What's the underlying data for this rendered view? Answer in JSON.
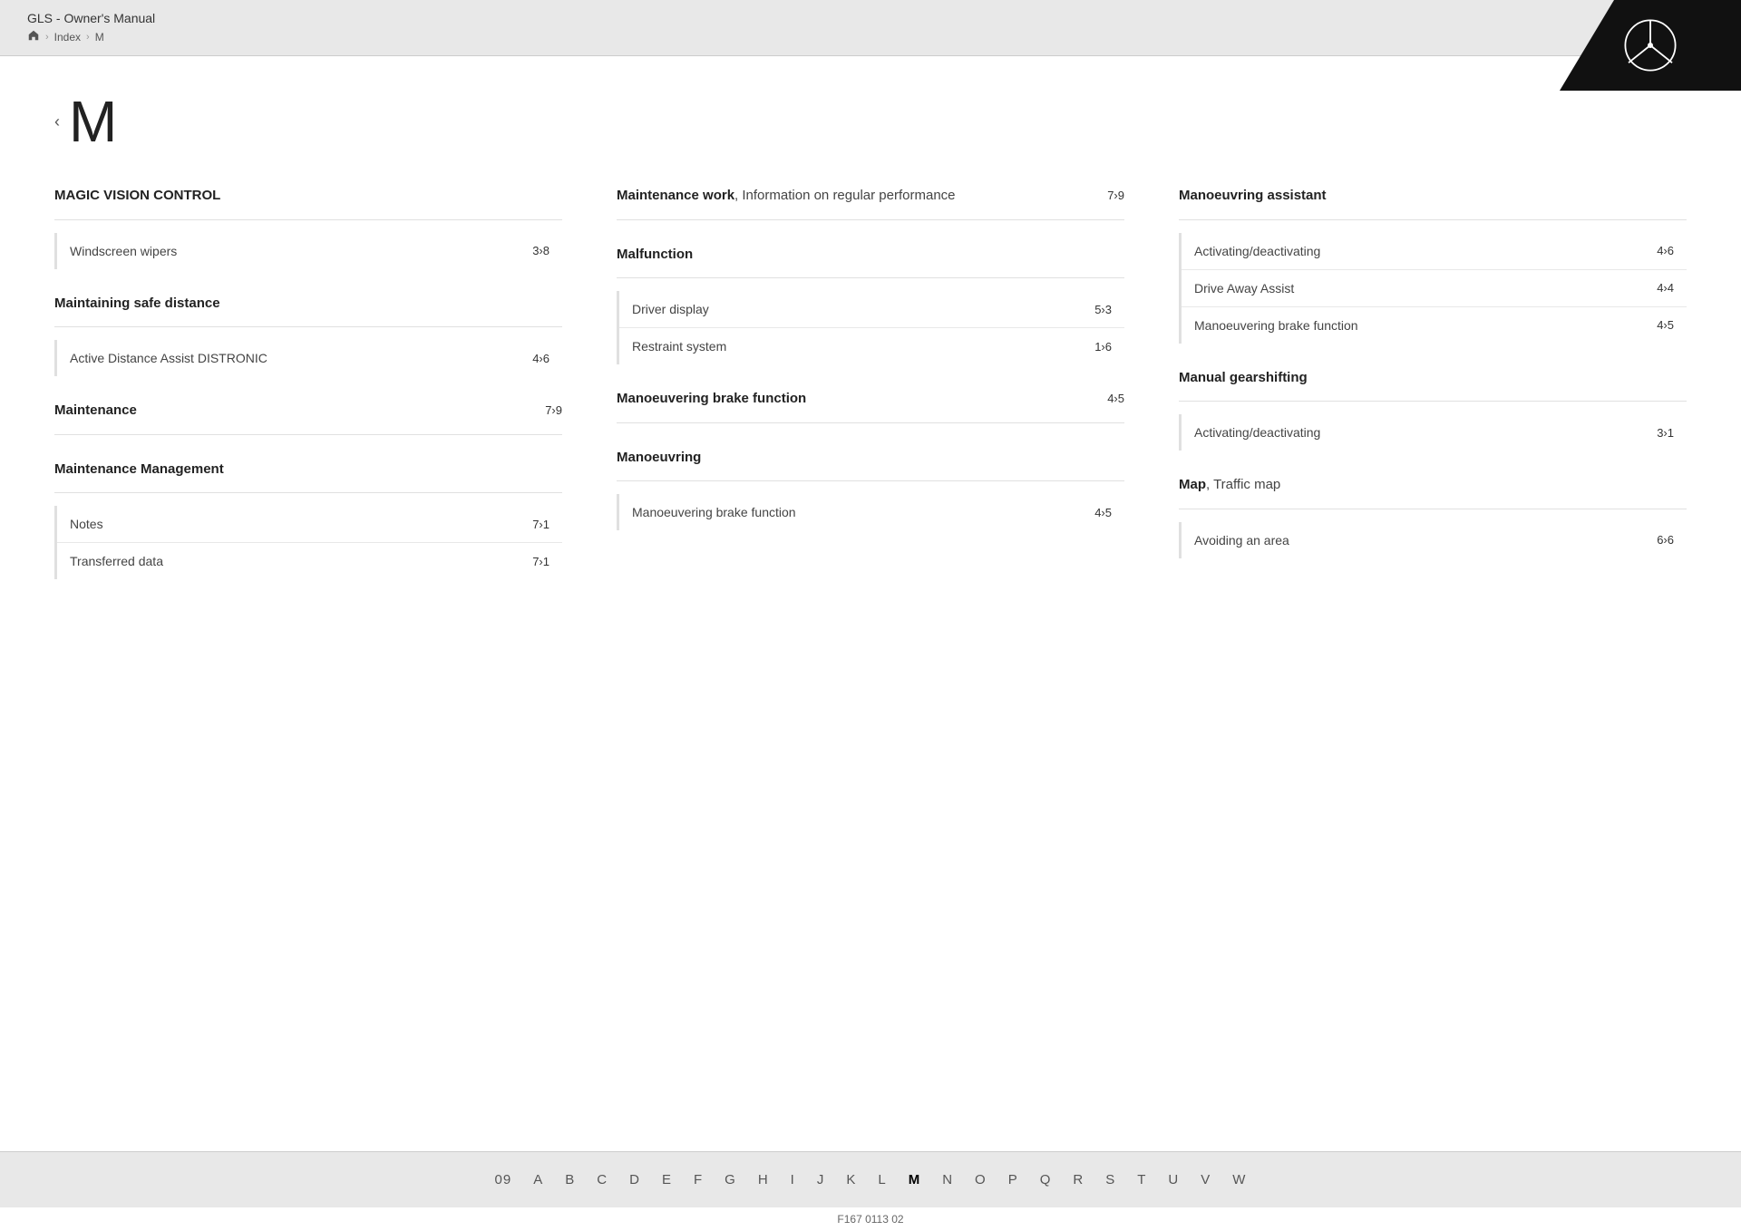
{
  "header": {
    "title": "GLS - Owner's Manual",
    "breadcrumb": [
      "Index",
      "M"
    ],
    "home_label": "home"
  },
  "page_letter": "M",
  "prev_arrow": "‹",
  "columns": [
    {
      "sections": [
        {
          "id": "magic-vision-control",
          "title": "MAGIC VISION CONTROL",
          "title_bold": true,
          "page_ref": null,
          "sub_items": [
            {
              "label": "Windscreen wipers",
              "page": "3›8"
            }
          ]
        },
        {
          "id": "maintaining-safe-distance",
          "title": "Maintaining safe distance",
          "title_bold": true,
          "page_ref": null,
          "sub_items": [
            {
              "label": "Active Distance Assist DISTRONIC",
              "page": "4›6"
            }
          ]
        },
        {
          "id": "maintenance",
          "title": "Maintenance",
          "title_bold": true,
          "page_ref": "7›9",
          "sub_items": []
        },
        {
          "id": "maintenance-management",
          "title": "Maintenance Management",
          "title_bold": true,
          "page_ref": null,
          "sub_items": [
            {
              "label": "Notes",
              "page": "7›1"
            },
            {
              "label": "Transferred data",
              "page": "7›1"
            }
          ]
        }
      ]
    },
    {
      "sections": [
        {
          "id": "maintenance-work",
          "title": "Maintenance work",
          "title_bold": true,
          "title_suffix": ", Information on regular performance",
          "page_ref": "7›9",
          "sub_items": []
        },
        {
          "id": "malfunction",
          "title": "Malfunction",
          "title_bold": true,
          "page_ref": null,
          "sub_items": [
            {
              "label": "Driver display",
              "page": "5›3"
            },
            {
              "label": "Restraint system",
              "page": "1›6"
            }
          ]
        },
        {
          "id": "manoeuvering-brake-mid",
          "title": "Manoeuvering brake function",
          "title_bold": true,
          "page_ref": "4›5",
          "sub_items": []
        },
        {
          "id": "manoeuvring",
          "title": "Manoeuvring",
          "title_bold": true,
          "page_ref": null,
          "sub_items": [
            {
              "label": "Manoeuvering brake function",
              "page": "4›5"
            }
          ]
        }
      ]
    },
    {
      "sections": [
        {
          "id": "manoeuvring-assistant",
          "title": "Manoeuvring assistant",
          "title_bold": true,
          "page_ref": null,
          "sub_items": [
            {
              "label": "Activating/deactivating",
              "page": "4›6"
            },
            {
              "label": "Drive Away Assist",
              "page": "4›4"
            },
            {
              "label": "Manoeuvering brake function",
              "page": "4›5"
            }
          ]
        },
        {
          "id": "manual-gearshifting",
          "title": "Manual gearshifting",
          "title_bold": true,
          "page_ref": null,
          "sub_items": [
            {
              "label": "Activating/deactivating",
              "page": "3›1"
            }
          ]
        },
        {
          "id": "map",
          "title": "Map",
          "title_bold": true,
          "title_suffix": ", Traffic map",
          "page_ref": null,
          "sub_items": [
            {
              "label": "Avoiding an area",
              "page": "6›6"
            }
          ]
        }
      ]
    }
  ],
  "alphabet": [
    {
      "label": "09",
      "active": false
    },
    {
      "label": "A",
      "active": false
    },
    {
      "label": "B",
      "active": false
    },
    {
      "label": "C",
      "active": false
    },
    {
      "label": "D",
      "active": false
    },
    {
      "label": "E",
      "active": false
    },
    {
      "label": "F",
      "active": false
    },
    {
      "label": "G",
      "active": false
    },
    {
      "label": "H",
      "active": false
    },
    {
      "label": "I",
      "active": false
    },
    {
      "label": "J",
      "active": false
    },
    {
      "label": "K",
      "active": false
    },
    {
      "label": "L",
      "active": false
    },
    {
      "label": "M",
      "active": true
    },
    {
      "label": "N",
      "active": false
    },
    {
      "label": "O",
      "active": false
    },
    {
      "label": "P",
      "active": false
    },
    {
      "label": "Q",
      "active": false
    },
    {
      "label": "R",
      "active": false
    },
    {
      "label": "S",
      "active": false
    },
    {
      "label": "T",
      "active": false
    },
    {
      "label": "U",
      "active": false
    },
    {
      "label": "V",
      "active": false
    },
    {
      "label": "W",
      "active": false
    }
  ],
  "doc_number": "F167 0113 02"
}
